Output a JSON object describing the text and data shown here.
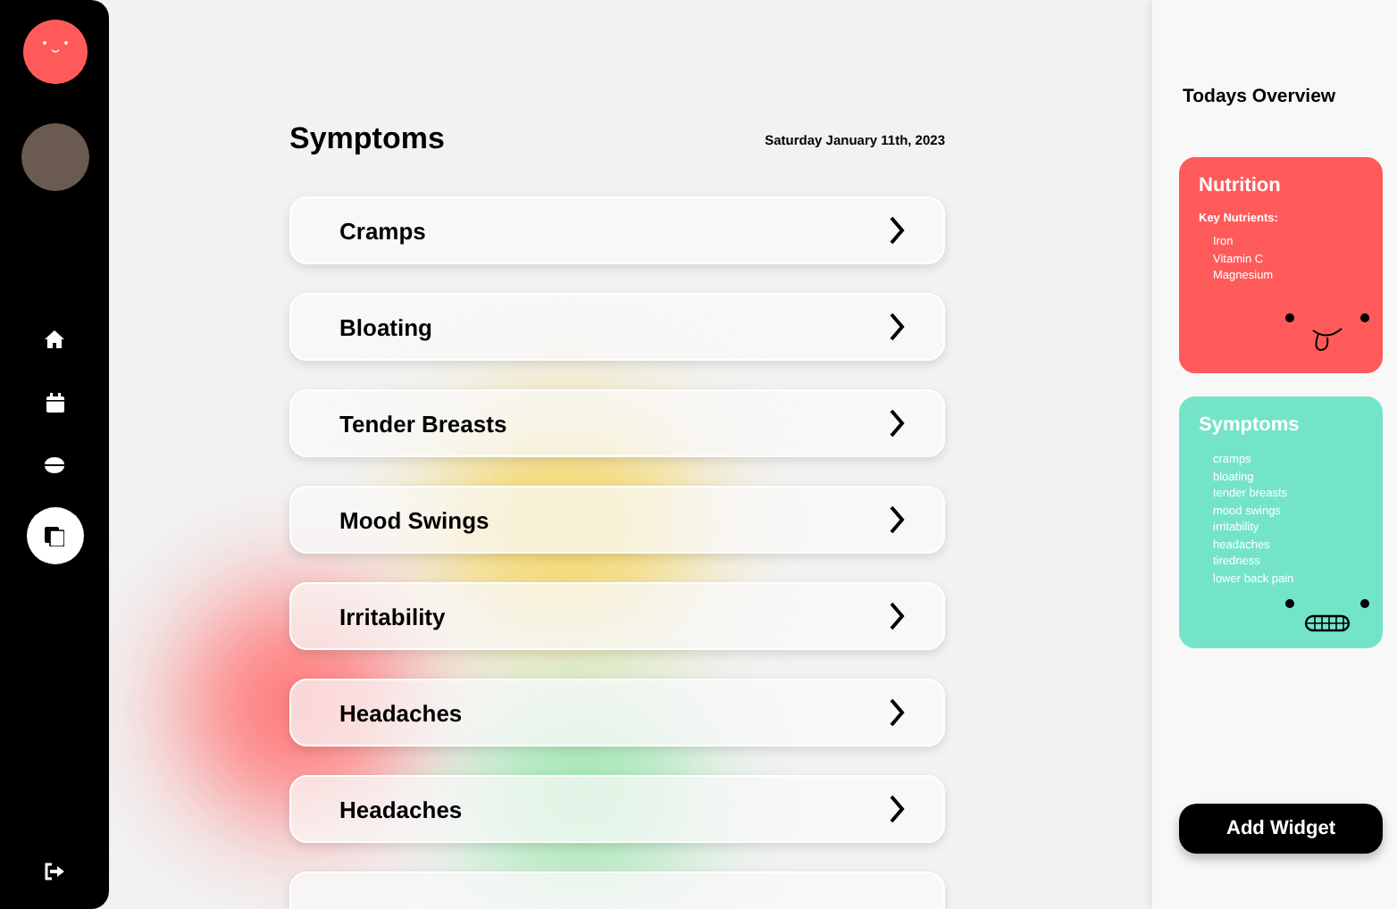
{
  "sidebar": {
    "nav": [
      {
        "kind": "home",
        "selected": false
      },
      {
        "kind": "calendar",
        "selected": false
      },
      {
        "kind": "bowl",
        "selected": false
      },
      {
        "kind": "documents",
        "selected": true
      }
    ]
  },
  "main": {
    "title": "Symptoms",
    "date": "Saturday January 11th, 2023",
    "symptoms": [
      {
        "label": "Cramps"
      },
      {
        "label": "Bloating"
      },
      {
        "label": "Tender Breasts"
      },
      {
        "label": "Mood Swings"
      },
      {
        "label": "Irritability"
      },
      {
        "label": "Headaches"
      },
      {
        "label": "Headaches"
      }
    ]
  },
  "overview": {
    "title": "Todays Overview",
    "widgets": [
      {
        "kind": "nutrition",
        "title": "Nutrition",
        "subtitle": "Key Nutrients:",
        "color": "#ff5a5a",
        "items": [
          "Iron",
          "Vitamin C",
          "Magnesium"
        ]
      },
      {
        "kind": "symptoms",
        "title": "Symptoms",
        "color": "#74e4c8",
        "items": [
          "cramps",
          "bloating",
          "tender breasts",
          "mood swings",
          "irritability",
          "headaches",
          "tiredness",
          "lower back pain"
        ]
      }
    ],
    "button": "Add Widget"
  }
}
